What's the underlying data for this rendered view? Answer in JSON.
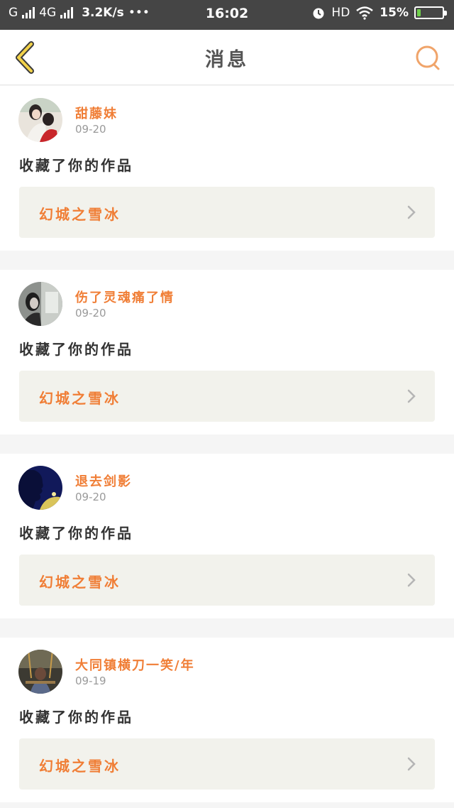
{
  "status_bar": {
    "carrier": "G",
    "network": "4G",
    "speed": "3.2K/s",
    "dots": "•••",
    "time": "16:02",
    "hd": "HD",
    "battery": "15%",
    "battery_level": 0.15,
    "icons": [
      "signal-icon",
      "alarm-icon",
      "wifi-icon",
      "battery-icon"
    ]
  },
  "header": {
    "title": "消息",
    "back_icon": "chevron-left-icon",
    "search_icon": "search-icon",
    "accent": "#f07e36"
  },
  "messages": [
    {
      "name": "甜藤妹",
      "date": "09-20",
      "action": "收藏了你的作品",
      "work": "幻城之雪冰"
    },
    {
      "name": "伤了灵魂痛了情",
      "date": "09-20",
      "action": "收藏了你的作品",
      "work": "幻城之雪冰"
    },
    {
      "name": "退去剑影",
      "date": "09-20",
      "action": "收藏了你的作品",
      "work": "幻城之雪冰"
    },
    {
      "name": "大同镇横刀一笑/年",
      "date": "09-19",
      "action": "收藏了你的作品",
      "work": "幻城之雪冰"
    }
  ]
}
